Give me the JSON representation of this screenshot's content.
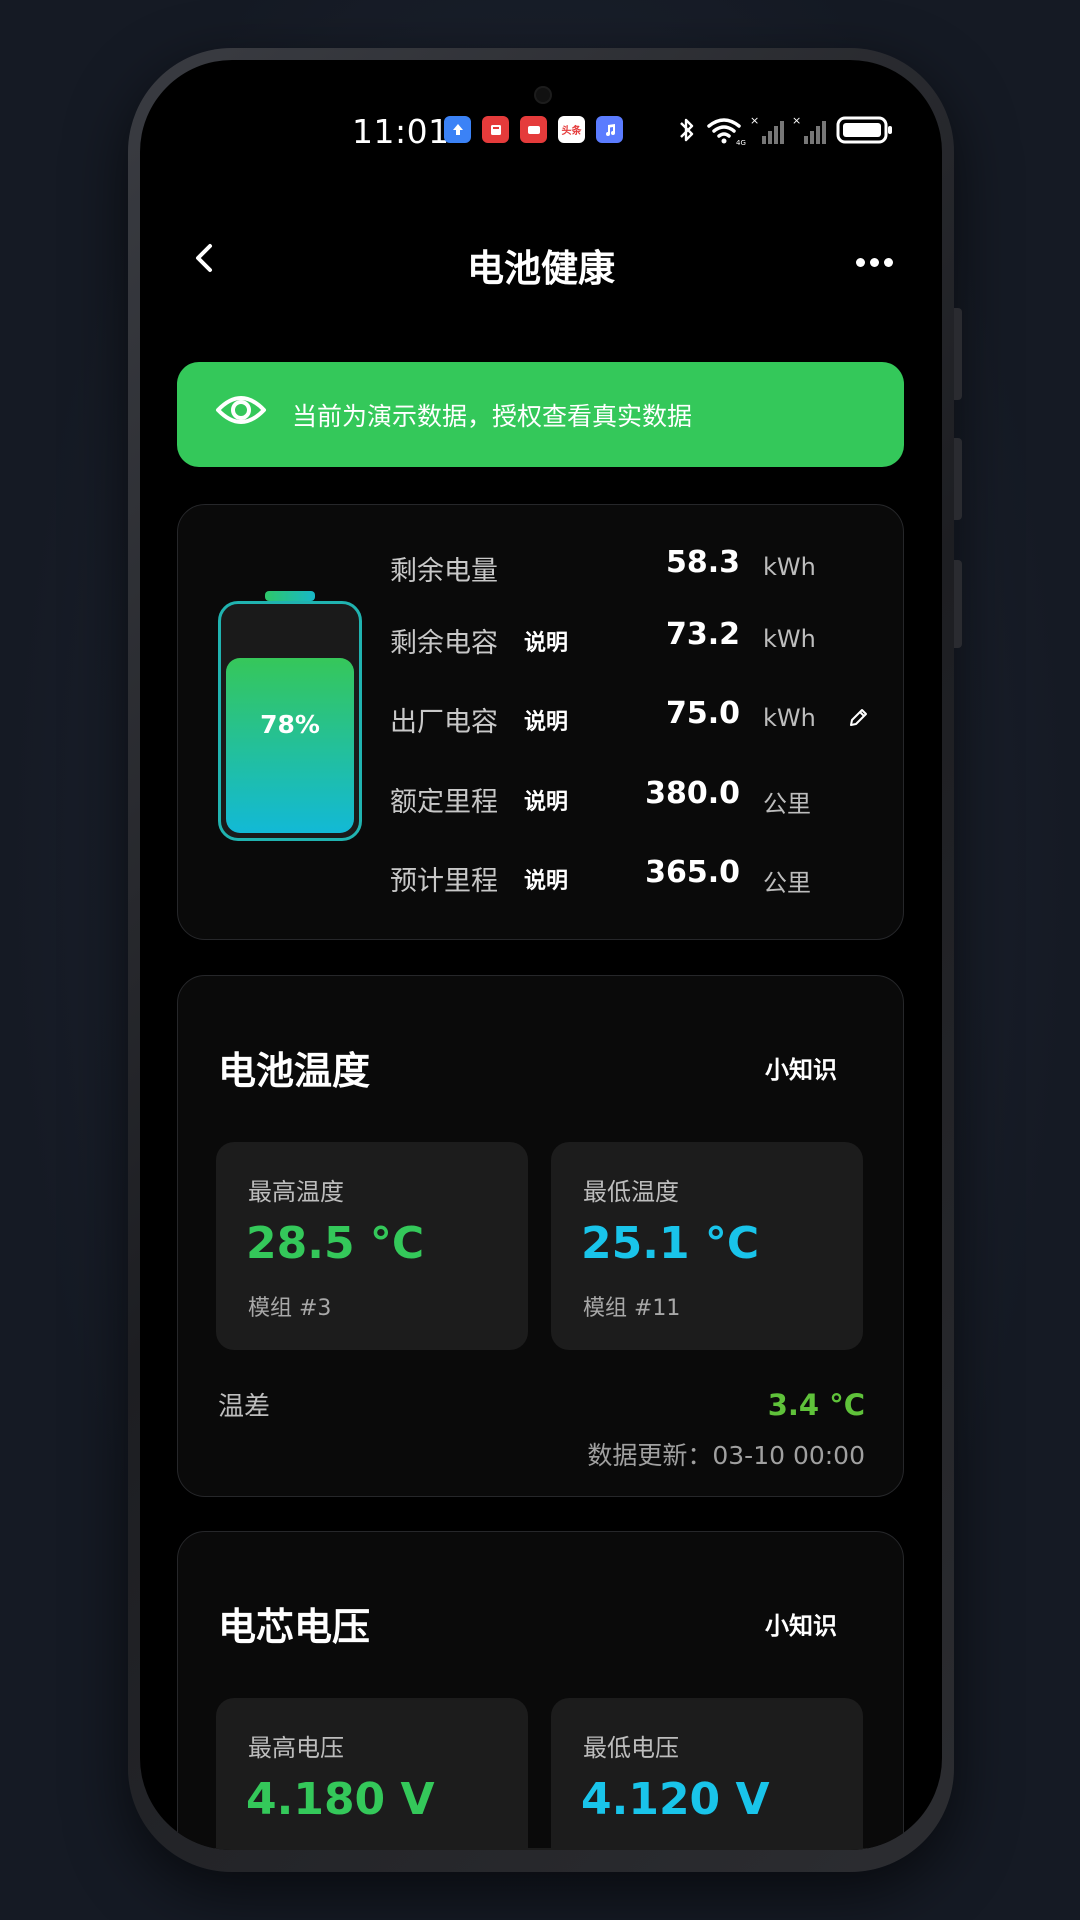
{
  "status_bar": {
    "time": "11:01",
    "apps": [
      {
        "icon": "upload-app-icon",
        "color": "#3b82f6",
        "glyph": "⬆"
      },
      {
        "icon": "book-app-icon",
        "color": "#e53b3b",
        "glyph": "▮"
      },
      {
        "icon": "reader-app-icon",
        "color": "#e53b3b",
        "glyph": "▬"
      },
      {
        "icon": "news-app-icon",
        "color": "#e53b3b",
        "text": "头条"
      },
      {
        "icon": "music-app-icon",
        "color": "#5b7cff",
        "glyph": "♫"
      }
    ]
  },
  "nav": {
    "title": "电池健康"
  },
  "banner": {
    "text": "当前为演示数据，授权查看真实数据",
    "color": "#34c85a"
  },
  "battery_card": {
    "level_percent": 78,
    "level_label": "78%",
    "stats": [
      {
        "label": "剩余电量",
        "explain": "",
        "value": "58.3",
        "unit": "kWh",
        "editable": false
      },
      {
        "label": "剩余电容",
        "explain": "说明",
        "value": "73.2",
        "unit": "kWh",
        "editable": false
      },
      {
        "label": "出厂电容",
        "explain": "说明",
        "value": "75.0",
        "unit": "kWh",
        "editable": true
      },
      {
        "label": "额定里程",
        "explain": "说明",
        "value": "380.0",
        "unit": "公里",
        "editable": false
      },
      {
        "label": "预计里程",
        "explain": "说明",
        "value": "365.0",
        "unit": "公里",
        "editable": false
      }
    ]
  },
  "temperature_card": {
    "title": "电池温度",
    "tip": "小知识",
    "max": {
      "label": "最高温度",
      "value": "28.5 °C",
      "sub": "模组 #3"
    },
    "min": {
      "label": "最低温度",
      "value": "25.1 °C",
      "sub": "模组 #11"
    },
    "diff_label": "温差",
    "diff_value": "3.4 °C",
    "updated": "数据更新：03-10 00:00"
  },
  "voltage_card": {
    "title": "电芯电压",
    "tip": "小知识",
    "max": {
      "label": "最高电压",
      "value": "4.180 V"
    },
    "min": {
      "label": "最低电压",
      "value": "4.120 V"
    }
  },
  "colors": {
    "accent_green": "#34c85a",
    "accent_cyan": "#19c4ea",
    "background": "#000000"
  }
}
